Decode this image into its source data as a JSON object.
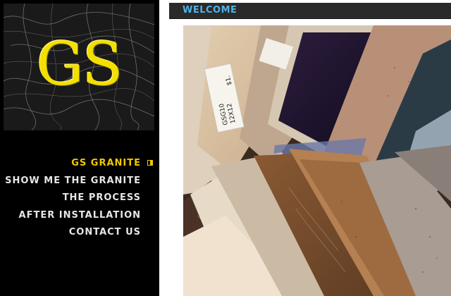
{
  "logo": {
    "text": "GS",
    "text_color": "#f3e000"
  },
  "nav": {
    "items": [
      {
        "label": "GS GRANITE",
        "active": true
      },
      {
        "label": "SHOW ME THE GRANITE",
        "active": false
      },
      {
        "label": "THE PROCESS",
        "active": false
      },
      {
        "label": "AFTER INSTALLATION",
        "active": false
      },
      {
        "label": "CONTACT US",
        "active": false
      }
    ],
    "active_color": "#f0c800",
    "text_color": "#e6e6e6"
  },
  "main": {
    "heading": "WELCOME",
    "heading_color": "#4fb3e8",
    "hero_tags": [
      {
        "text": "GSG10"
      },
      {
        "text": "12X12"
      },
      {
        "text": "$1."
      }
    ]
  }
}
